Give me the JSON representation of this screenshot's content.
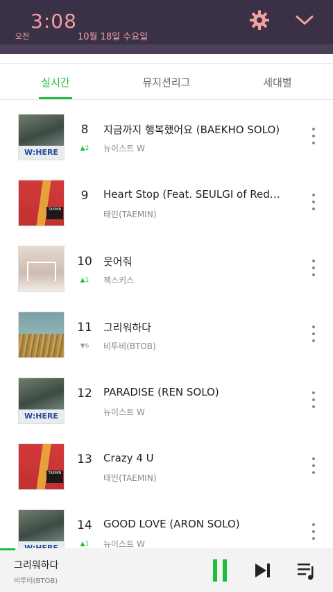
{
  "status": {
    "time": "3:08",
    "ampm": "오전",
    "date": "10월 18일 수요일",
    "icons": [
      "gear-icon",
      "chevron-down-icon"
    ],
    "accent_color": "#f4a0a0",
    "bar_color": "#3a3147"
  },
  "tabs": [
    {
      "label": "실시간",
      "active": true
    },
    {
      "label": "뮤지션리그",
      "active": false
    },
    {
      "label": "세대별",
      "active": false
    }
  ],
  "chart": {
    "accent_color": "#1dbf3a",
    "rows": [
      {
        "rank": "8",
        "change": "▲2",
        "dir": "up",
        "title": "지금까지 행복했어요 (BAEKHO SOLO)",
        "artist": "뉴이스트 W",
        "cover": "a",
        "cover_text": "W:HERE"
      },
      {
        "rank": "9",
        "change": "",
        "dir": "none",
        "title": "Heart Stop (Feat. SEULGI of Red…",
        "artist": "태민(TAEMIN)",
        "cover": "b",
        "cover_text": "TAEMIN"
      },
      {
        "rank": "10",
        "change": "▲1",
        "dir": "up",
        "title": "웃어줘",
        "artist": "젝스키스",
        "cover": "c",
        "cover_text": ""
      },
      {
        "rank": "11",
        "change": "▼6",
        "dir": "down",
        "title": "그리워하다",
        "artist": "비투비(BTOB)",
        "cover": "d",
        "cover_text": ""
      },
      {
        "rank": "12",
        "change": "",
        "dir": "none",
        "title": "PARADISE (REN SOLO)",
        "artist": "뉴이스트 W",
        "cover": "a",
        "cover_text": "W:HERE"
      },
      {
        "rank": "13",
        "change": "",
        "dir": "none",
        "title": "Crazy 4 U",
        "artist": "태민(TAEMIN)",
        "cover": "b",
        "cover_text": "TAEMIN"
      },
      {
        "rank": "14",
        "change": "▲1",
        "dir": "up",
        "title": "GOOD LOVE (ARON SOLO)",
        "artist": "뉴이스트 W",
        "cover": "a",
        "cover_text": "W:HERE"
      }
    ]
  },
  "player": {
    "title": "그리워하다",
    "artist": "비투비(BTOB)",
    "progress": 0.046,
    "icons": [
      "pause-icon",
      "next-track-icon",
      "playlist-icon"
    ]
  }
}
